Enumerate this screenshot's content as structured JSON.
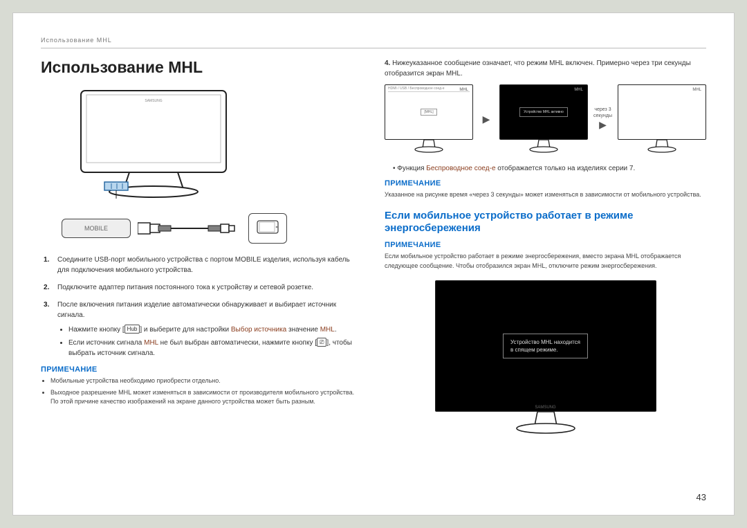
{
  "header": {
    "breadcrumb": "Использование MHL"
  },
  "title": "Использование MHL",
  "mobile_label": "MOBILE",
  "steps": {
    "s1": "Соедините USB-порт мобильного устройства с портом MOBILE изделия, используя кабель для подключения мобильного устройства.",
    "s2": "Подключите адаптер питания постоянного тока к устройству и сетевой розетке.",
    "s3_a": "После включения питания изделие автоматически обнаруживает и выбирает источник сигнала.",
    "s3_b_pre": "Нажмите кнопку [",
    "s3_b_hub": "Hub",
    "s3_b_mid": "] и выберите для настройки ",
    "s3_b_brown1": "Выбор источника",
    "s3_b_mid2": " значение ",
    "s3_b_brown2": "MHL",
    "s3_b_end": ".",
    "s3_c_pre": "Если источник сигнала ",
    "s3_c_brown": "MHL",
    "s3_c_mid": " не был выбран автоматически, нажмите кнопку [",
    "s3_c_end": "], чтобы выбрать источник сигнала."
  },
  "notice_label": "Примечание",
  "notice_left": {
    "b1": "Мобильные устройства необходимо приобрести отдельно.",
    "b2": "Выходное разрешение MHL может изменяться в зависимости от производителя мобильного устройства. По этой причине качество изображений на экране данного устройства может быть разным."
  },
  "right": {
    "s4_pre": "4.",
    "s4_text": "Нижеуказанное сообщение означает, что режим MHL включен. Примерно через три секунды отобразится экран MHL.",
    "screen1_topbar": "HDMI / USB / Беспроводное соед-е",
    "mhl_corner": "MHL",
    "screen1_pill": "[MHL]",
    "arrow_text": "через 3 секунды",
    "screen2_msg": "Устройство MHL активно",
    "bullet_pre": "Функция ",
    "bullet_brown": "Беспроводное соед-е",
    "bullet_post": " отображается только на изделиях серии 7.",
    "notice1_body": "Указанное на рисунке время «через 3 секунды» может изменяться в зависимости от мобильного устройства.",
    "blue_heading": "Если мобильное устройство работает в режиме энергосбережения",
    "notice2_body": "Если мобильное устройство работает в режиме энергосбережения, вместо экрана MHL отображается следующее сообщение. Чтобы отобразился экран MHL, отключите режим энергосбережения.",
    "big_msg_l1": "Устройство MHL находится",
    "big_msg_l2": "в спящем режиме.",
    "brand": "SAMSUNG"
  },
  "page_number": "43"
}
